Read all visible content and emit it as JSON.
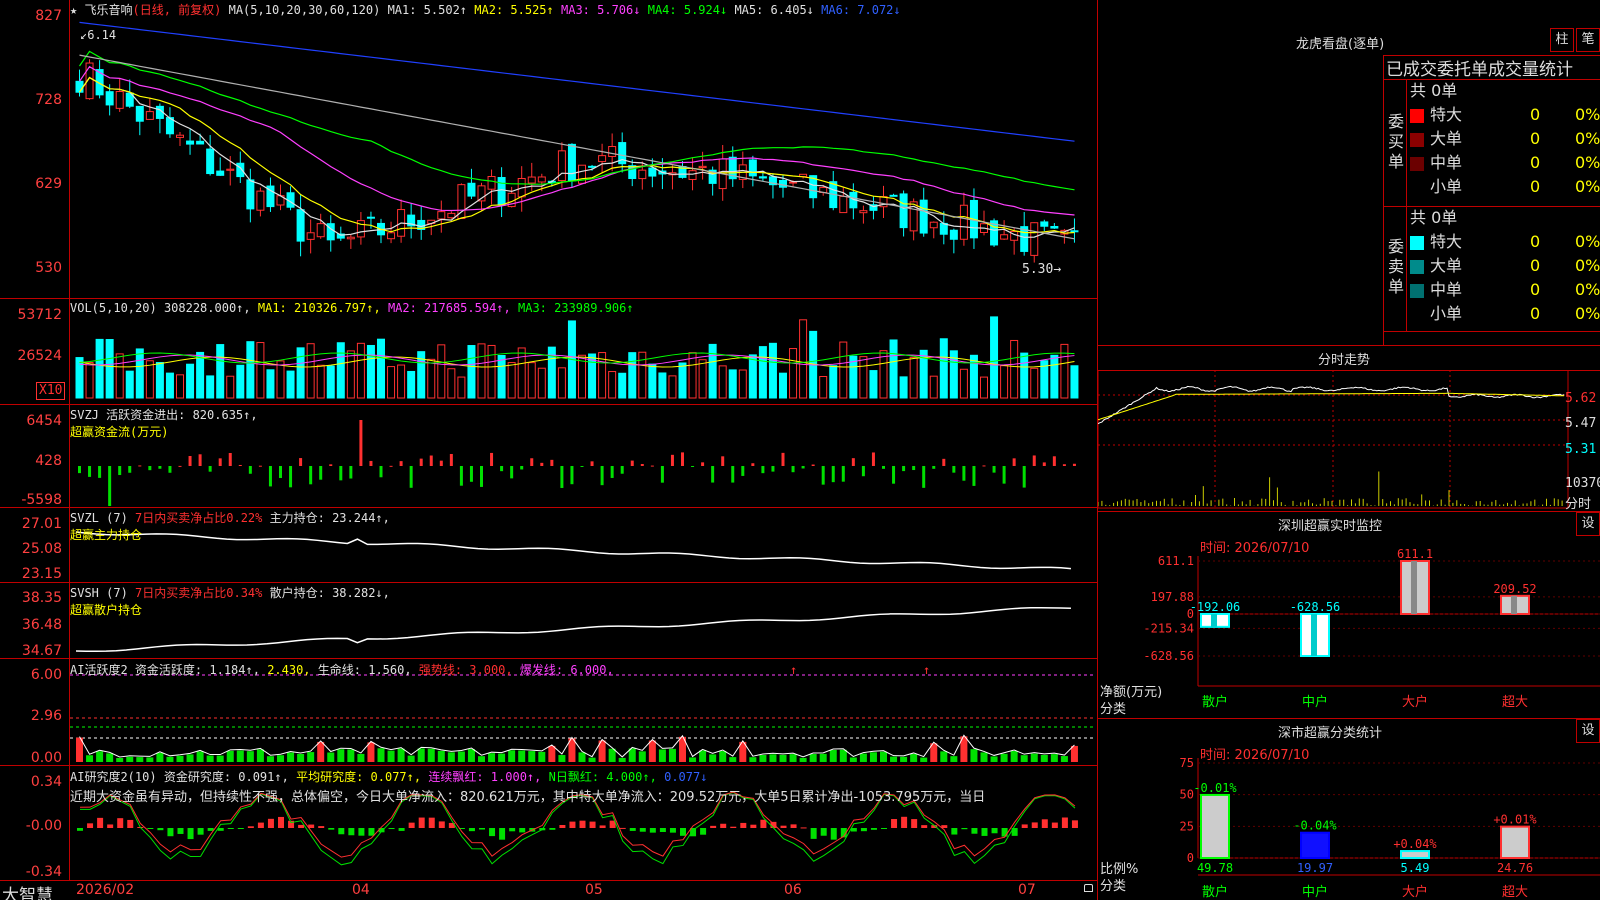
{
  "app": {
    "brand": "大智慧",
    "stock_name": "飞乐音响",
    "period": "(日线, 前复权)"
  },
  "colors": {
    "up": "#ff3030",
    "down": "#00ffff",
    "border": "#c00000",
    "ma1": "#e0e0e0",
    "ma2": "#ffff00",
    "ma3": "#ff40ff",
    "ma4": "#00ff00",
    "ma5": "#b0b0b0",
    "ma6": "#2040ff"
  },
  "price_panel": {
    "ma_header": "MA(5,10,20,30,60,120)",
    "ma1": "MA1: 5.502↑",
    "ma2": "MA2: 5.525↑",
    "ma3": "MA3: 5.706↓",
    "ma4": "MA4: 5.924↓",
    "ma5": "MA5: 6.405↓",
    "ma6": "MA6: 7.072↓",
    "y_ticks": [
      "827",
      "728",
      "629",
      "530"
    ],
    "high_marker": "6.14",
    "low_marker": "5.30"
  },
  "vol_panel": {
    "header": "VOL(5,10,20)",
    "value": "308228.000↑,",
    "ma1": "MA1: 210326.797↑,",
    "ma2": "MA2: 217685.594↑,",
    "ma3": "MA3: 233989.906↑",
    "y_ticks": [
      "53712",
      "26524"
    ],
    "unit": "X10"
  },
  "svzj_panel": {
    "header": "SVZJ  活跃资金进出: 820.635↑,",
    "sub": "超赢资金流(万元)",
    "y_ticks": [
      "6454",
      "428",
      "-5598"
    ]
  },
  "svzl_panel": {
    "header": "SVZL (7)",
    "ratio": "7日内买卖净占比0.22%",
    "holding": "主力持仓: 23.244↑,",
    "sub": "超赢主力持仓",
    "y_ticks": [
      "27.01",
      "25.08",
      "23.15"
    ]
  },
  "svsh_panel": {
    "header": "SVSH (7)",
    "ratio": "7日内买卖净占比0.34%",
    "holding": "散户持仓: 38.282↓,",
    "sub": "超赢散户持仓",
    "y_ticks": [
      "38.35",
      "36.48",
      "34.67"
    ]
  },
  "ai_active_panel": {
    "header": "AI活跃度2",
    "active": "资金活跃度: 1.184↑,",
    "v2": "2.430,",
    "life": "生命线: 1.560,",
    "strong": "强势线: 3.000,",
    "burst": "爆发线: 6.000,",
    "y_ticks": [
      "6.00",
      "2.96",
      "0.00"
    ]
  },
  "ai_research_panel": {
    "header": "AI研究度2(10)",
    "research": "资金研究度: 0.091↑,",
    "avg": "平均研究度: 0.077↑,",
    "red": "连续飘红: 1.000↑,",
    "nred": "N日飘红: 4.000↑,",
    "last": "0.077↓",
    "note": "近期大资金虽有异动，但持续性不强，总体偏空，今日大单净流入：820.621万元，其中特大单净流入：209.52万元，大单5日累计净出-1053.795万元，当日",
    "y_ticks": [
      "0.34",
      "-0.00",
      "-0.34"
    ]
  },
  "x_axis": {
    "dates": [
      "2026/02",
      "04",
      "05",
      "06",
      "07"
    ]
  },
  "longhu": {
    "title": "龙虎看盘(逐单)",
    "btn_zhu": "柱",
    "btn_bi": "笔",
    "subtitle": "已成交委托单成交量统计",
    "buy_label": "委买单",
    "sell_label": "委卖单",
    "buy_total": "共 0单",
    "sell_total": "共 0单",
    "buy_rows": [
      {
        "name": "特大",
        "count": "0",
        "pct": "0%",
        "color": "#ff0000"
      },
      {
        "name": "大单",
        "count": "0",
        "pct": "0%",
        "color": "#8b0000"
      },
      {
        "name": "中单",
        "count": "0",
        "pct": "0%",
        "color": "#6b0000"
      },
      {
        "name": "小单",
        "count": "0",
        "pct": "0%",
        "color": ""
      }
    ],
    "sell_rows": [
      {
        "name": "特大",
        "count": "0",
        "pct": "0%",
        "color": "#00ffff"
      },
      {
        "name": "大单",
        "count": "0",
        "pct": "0%",
        "color": "#008b8b"
      },
      {
        "name": "中单",
        "count": "0",
        "pct": "0%",
        "color": "#007070"
      },
      {
        "name": "小单",
        "count": "0",
        "pct": "0%",
        "color": ""
      }
    ]
  },
  "intraday": {
    "title": "分时走势",
    "y_ticks": [
      "5.62",
      "5.47",
      "5.31"
    ],
    "vol_label": "10370",
    "unit": "分时"
  },
  "sz_monitor": {
    "title": "深圳超赢实时监控",
    "btn": "设",
    "time": "时间: 2026/07/10",
    "y_ticks": [
      "611.1",
      "197.88",
      "0",
      "-215.34",
      "-628.56"
    ],
    "y_title": "净额(万元)",
    "x_title": "分类",
    "categories": [
      "散户",
      "中户",
      "大户",
      "超大"
    ],
    "values": [
      -192.06,
      -628.56,
      611.1,
      209.52
    ],
    "value_labels": [
      "-192.06",
      "-628.56",
      "611.1",
      "209.52"
    ]
  },
  "sz_class": {
    "title": "深市超赢分类统计",
    "btn": "设",
    "time": "时间: 2026/07/10",
    "y_ticks": [
      "75",
      "50",
      "25",
      "0"
    ],
    "y_title": "比例%",
    "x_title": "分类",
    "categories": [
      "散户",
      "中户",
      "大户",
      "超大"
    ],
    "values": [
      49.78,
      19.97,
      5.49,
      24.76
    ],
    "value_labels": [
      "49.78",
      "19.97",
      "5.49",
      "24.76"
    ],
    "change_labels": [
      "-0.01%",
      "-0.04%",
      "+0.04%",
      "+0.01%"
    ]
  }
}
